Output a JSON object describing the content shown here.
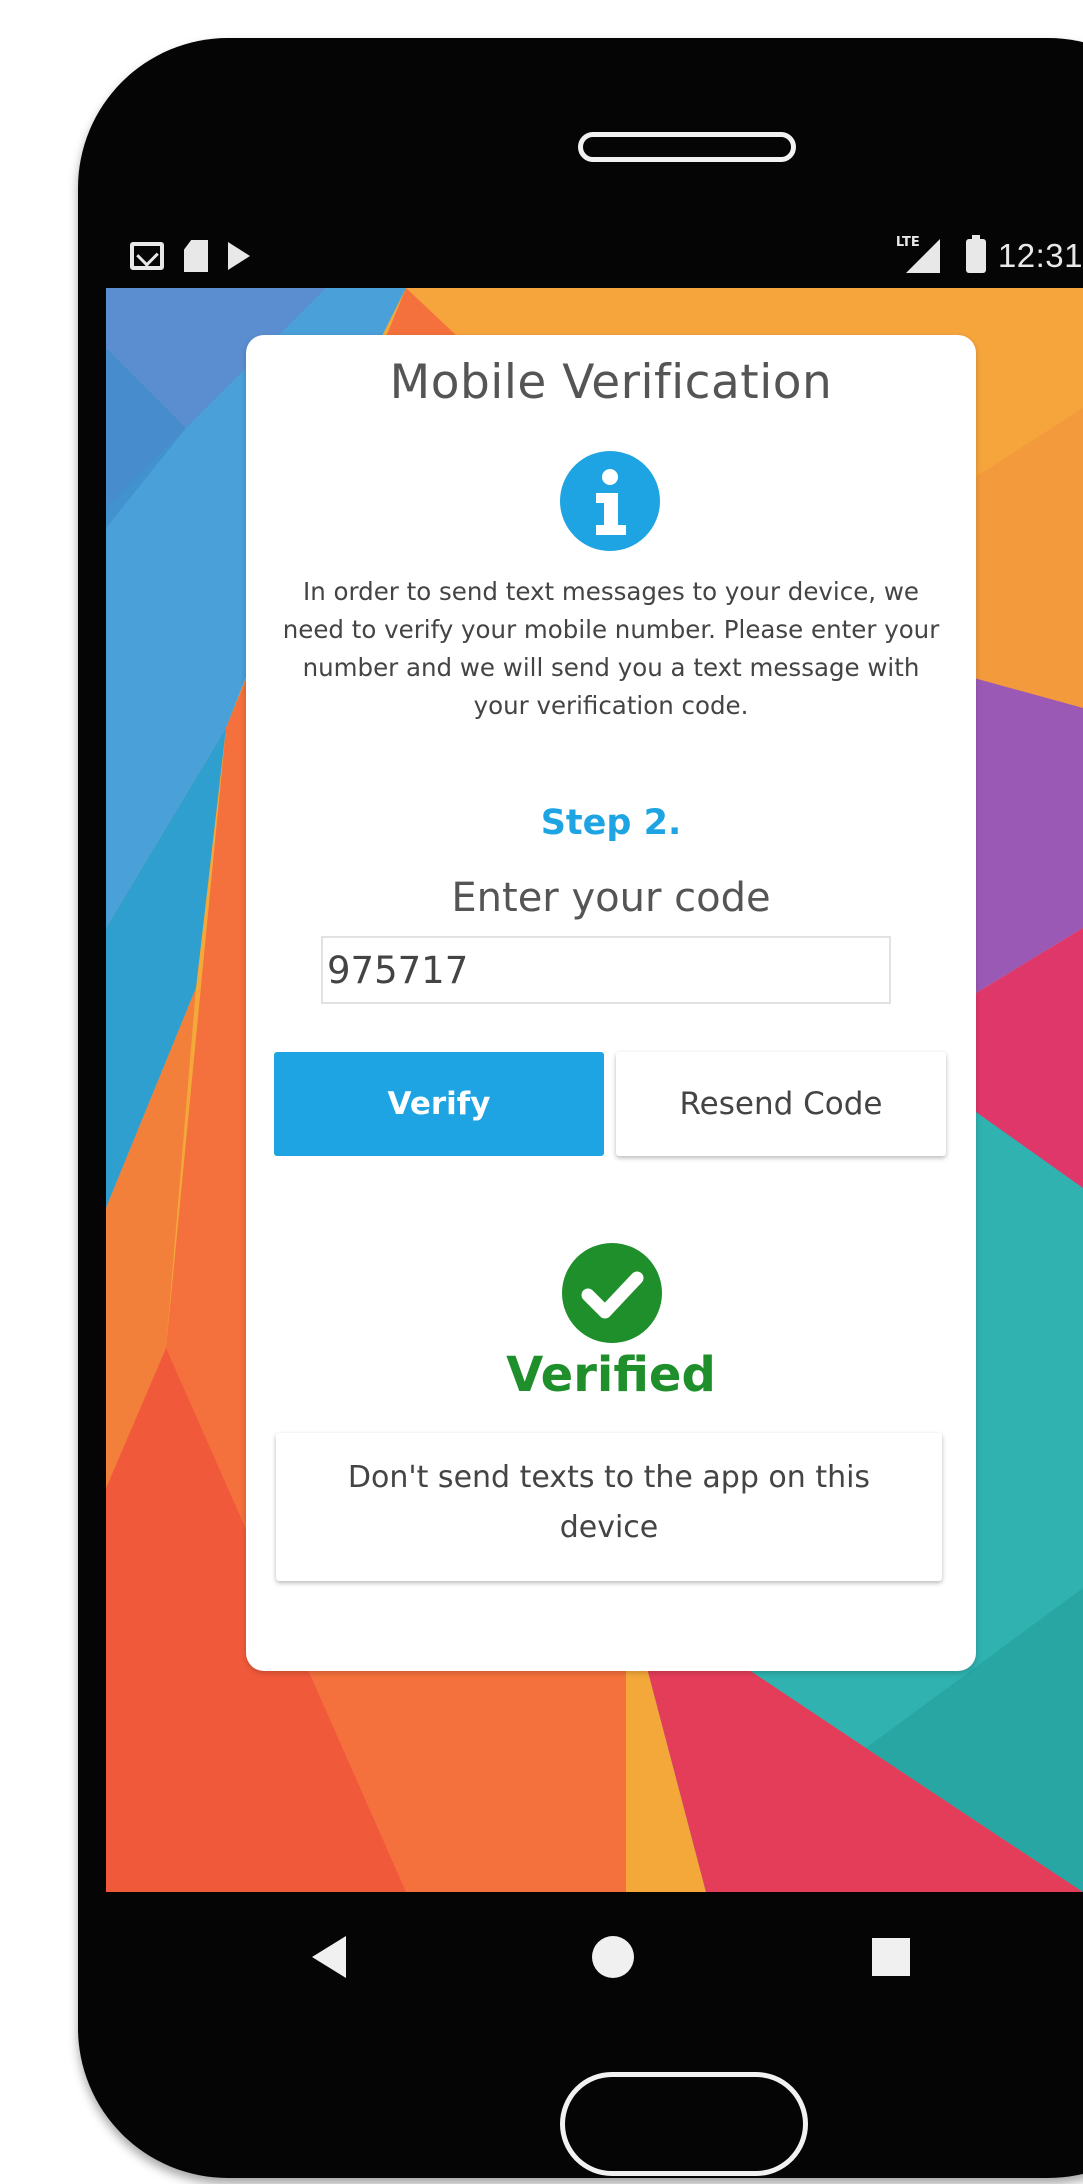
{
  "status_bar": {
    "time": "12:31",
    "network_label": "LTE",
    "left_icons": [
      "gmail-icon",
      "sim-card-icon",
      "play-store-icon"
    ],
    "right_icons": [
      "lte-signal-icon",
      "battery-icon"
    ]
  },
  "dialog": {
    "title": "Mobile Verification",
    "description": "In order to send text messages to your device, we need to verify your mobile number. Please enter your number and we will send you a text message with your verification code.",
    "step_label": "Step 2.",
    "code_label": "Enter your code",
    "code_value": "975717",
    "verify_button": "Verify",
    "resend_button": "Resend Code",
    "verified_label": "Verified",
    "dont_send_button": "Don't send texts to the app on this device"
  },
  "nav_bar": {
    "buttons": [
      "back-icon",
      "home-icon",
      "recents-icon"
    ]
  },
  "colors": {
    "accent": "#1ea4e2",
    "success": "#1f8f2c",
    "phone_body": "#050505",
    "card": "#ffffff"
  }
}
